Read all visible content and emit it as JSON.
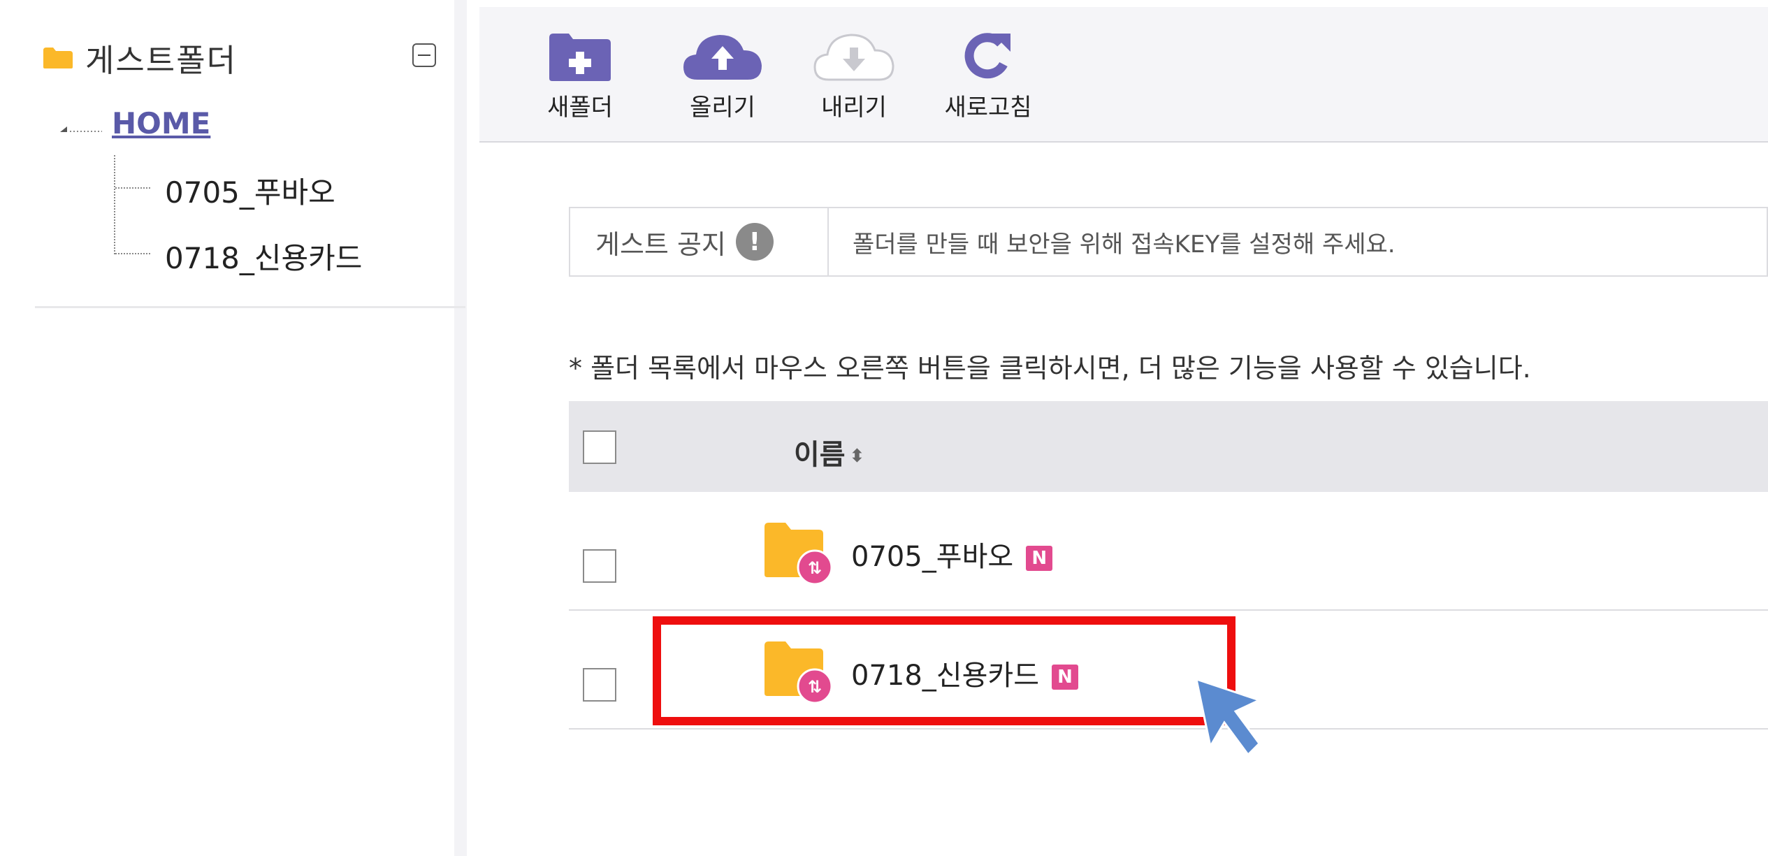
{
  "sidebar": {
    "title": "게스트폴더",
    "tree": {
      "home_label": "HOME",
      "items": [
        {
          "label": "0705_푸바오"
        },
        {
          "label": "0718_신용카드"
        }
      ]
    }
  },
  "toolbar": {
    "new_folder_label": "새폴더",
    "upload_label": "올리기",
    "download_label": "내리기",
    "refresh_label": "새로고침"
  },
  "notice": {
    "label": "게스트 공지",
    "icon_text": "!",
    "text": "폴더를 만들 때 보안을 위해 접속KEY를 설정해 주세요."
  },
  "hint": "* 폴더 목록에서 마우스 오른쪽 버튼을 클릭하시면, 더 많은 기능을 사용할 수 있습니다.",
  "table": {
    "name_header": "이름",
    "rows": [
      {
        "name": "0705_푸바오",
        "badge": "N"
      },
      {
        "name": "0718_신용카드",
        "badge": "N"
      }
    ]
  },
  "colors": {
    "accent": "#6b63b5",
    "folder": "#fbb829",
    "badge": "#e24a8f",
    "highlight": "#ee0e0e",
    "cursor": "#5b8bd0"
  }
}
